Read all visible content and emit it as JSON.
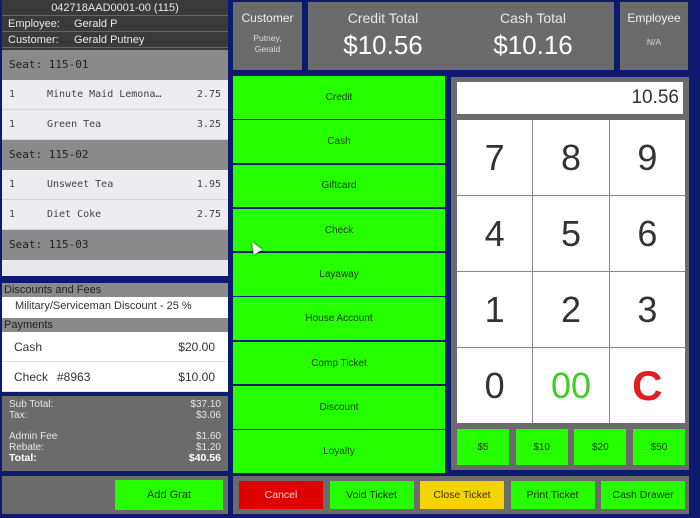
{
  "ticket": {
    "id": "042718AAD0001-00 (115)",
    "employee_label": "Employee:",
    "employee_value": "Gerald P",
    "customer_label": "Customer:",
    "customer_value": "Gerald Putney"
  },
  "seats": [
    {
      "label": "Seat: 115-01",
      "items": [
        {
          "qty": "1",
          "name": "Minute Maid Lemona…",
          "price": "2.75"
        },
        {
          "qty": "1",
          "name": "Green Tea",
          "price": "3.25"
        }
      ]
    },
    {
      "label": "Seat: 115-02",
      "items": [
        {
          "qty": "1",
          "name": "Unsweet Tea",
          "price": "1.95"
        },
        {
          "qty": "1",
          "name": "Diet Coke",
          "price": "2.75"
        }
      ]
    },
    {
      "label": "Seat: 115-03",
      "items": []
    }
  ],
  "discounts": {
    "heading": "Discounts and Fees",
    "items": [
      "Military/Serviceman Discount  - 25 %"
    ]
  },
  "payments": {
    "heading": "Payments",
    "items": [
      {
        "method": "Cash",
        "ref": "",
        "amount": "$20.00"
      },
      {
        "method": "Check",
        "ref": "#8963",
        "amount": "$10.00"
      }
    ]
  },
  "totals": {
    "subtotal_label": "Sub Total:",
    "subtotal": "$37.10",
    "tax_label": "Tax:",
    "tax": "$3.06",
    "admin_fee_label": "Admin Fee",
    "admin_fee": "$1.60",
    "rebate_label": "Rebate:",
    "rebate": "$1.20",
    "total_label": "Total:",
    "total": "$40.56"
  },
  "add_grat_label": "Add Grat",
  "header": {
    "customer_title": "Customer",
    "customer_name_line1": "Putney,",
    "customer_name_line2": "Gerald",
    "credit_total_label": "Credit Total",
    "credit_total": "$10.56",
    "cash_total_label": "Cash Total",
    "cash_total": "$10.16",
    "employee_title": "Employee",
    "employee_value": "N/A"
  },
  "payment_methods": [
    "Credit",
    "Cash",
    "Giftcard",
    "Check",
    "Layaway",
    "House Account",
    "Comp Ticket",
    "Discount",
    "Loyalty"
  ],
  "keypad": {
    "display": "10.56",
    "keys": [
      "7",
      "8",
      "9",
      "4",
      "5",
      "6",
      "1",
      "2",
      "3",
      "0",
      "00",
      "C"
    ],
    "quick_cash": [
      "$5",
      "$10",
      "$20",
      "$50"
    ]
  },
  "actions": {
    "cancel": "Cancel",
    "void": "Void Ticket",
    "close": "Close Ticket",
    "print": "Print Ticket",
    "drawer": "Cash Drawer"
  },
  "colors": {
    "background": "#0d1a6e",
    "panel": "#6b6b6b",
    "button_green": "#25ff00",
    "cancel_red": "#e00000",
    "close_yellow": "#f4d400"
  }
}
